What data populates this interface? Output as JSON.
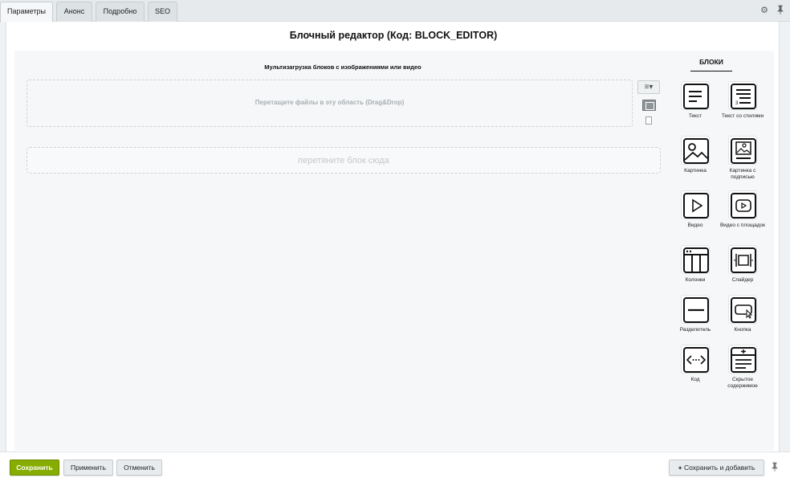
{
  "tabs": [
    {
      "label": "Параметры",
      "active": true
    },
    {
      "label": "Анонс",
      "active": false
    },
    {
      "label": "Подробно",
      "active": false
    },
    {
      "label": "SEO",
      "active": false
    }
  ],
  "toolbar_icons": [
    "settings-icon",
    "pin-icon"
  ],
  "editor": {
    "title": "Блочный редактор (Код: BLOCK_EDITOR)",
    "multiupload_title": "Мультизагрузка блоков с изображениями или видео",
    "dropzone_text": "Перетащите файлы в эту область (Drag&Drop)",
    "block_drop_text": "перетяните блок сюда"
  },
  "palette": {
    "title": "БЛОКИ",
    "blocks": [
      {
        "label": "Текст",
        "icon": "text-icon"
      },
      {
        "label": "Текст со стилями",
        "icon": "styled-text-icon"
      },
      {
        "label": "Картинка",
        "icon": "image-icon"
      },
      {
        "label": "Картинка с подписью",
        "icon": "image-caption-icon"
      },
      {
        "label": "Видео",
        "icon": "video-icon"
      },
      {
        "label": "Видео с площадок",
        "icon": "video-platform-icon"
      },
      {
        "label": "Колонки",
        "icon": "columns-icon"
      },
      {
        "label": "Слайдер",
        "icon": "slider-icon"
      },
      {
        "label": "Разделитель",
        "icon": "divider-icon"
      },
      {
        "label": "Кнопка",
        "icon": "button-icon"
      },
      {
        "label": "Код",
        "icon": "code-icon"
      },
      {
        "label": "Скрытое содержимое",
        "icon": "hidden-content-icon"
      }
    ]
  },
  "footer": {
    "save": "Сохранить",
    "apply": "Применить",
    "cancel": "Отменить",
    "save_and_add": "Сохранить и добавить"
  },
  "colors": {
    "primary_button": "#86ad00",
    "background": "#eef2f4",
    "workspace": "#f5f7f8"
  }
}
